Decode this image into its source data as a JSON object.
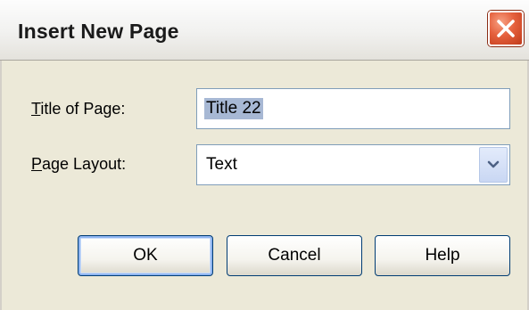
{
  "window": {
    "title": "Insert New Page",
    "close_icon": "close-icon"
  },
  "form": {
    "title_label": {
      "mnemonic": "T",
      "rest": "itle of Page:"
    },
    "title_value": "Title 22",
    "layout_label": {
      "mnemonic": "P",
      "rest": "age Layout:"
    },
    "layout_value": "Text",
    "dropdown_icon": "chevron-down-icon"
  },
  "buttons": {
    "ok": "OK",
    "cancel": "Cancel",
    "help": "Help"
  },
  "colors": {
    "close_button": "#e5603d",
    "selection_highlight": "#a7b8d4",
    "dialog_face": "#ece9d8",
    "field_border": "#7f9db9"
  }
}
